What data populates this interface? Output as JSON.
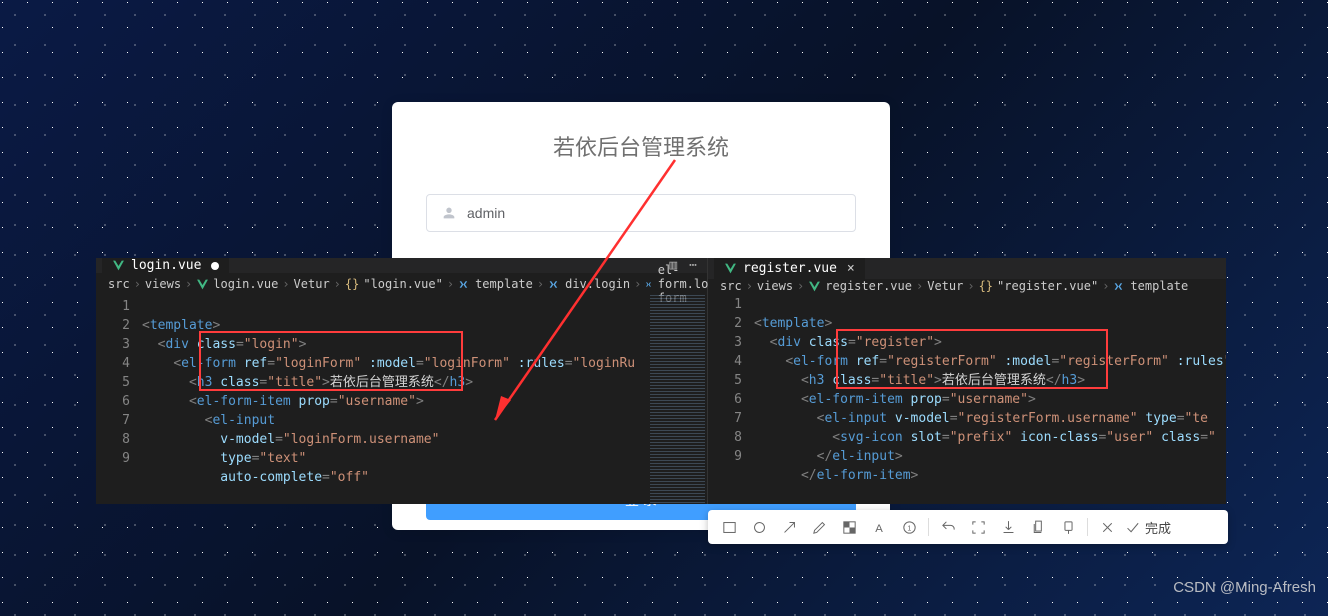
{
  "login_card": {
    "title": "若依后台管理系统",
    "username_value": "admin",
    "submit_label": "登 录"
  },
  "left_pane": {
    "tab": "login.vue",
    "breadcrumb": [
      "src",
      "views",
      "login.vue",
      "Vetur",
      "\"login.vue\"",
      "template",
      "div.login",
      "el-form.login-form"
    ],
    "lines": [
      "1",
      "2",
      "3",
      "4",
      "5",
      "6",
      "7",
      "8",
      "9"
    ]
  },
  "right_pane": {
    "tab": "register.vue",
    "breadcrumb": [
      "src",
      "views",
      "register.vue",
      "Vetur",
      "\"register.vue\"",
      "template"
    ],
    "lines": [
      "1",
      "2",
      "3",
      "4",
      "5",
      "6",
      "7",
      "8",
      "9"
    ]
  },
  "code_left": {
    "l1_template": "template",
    "l2_div": "div",
    "l2_class": "class",
    "l2_classv": "\"login\"",
    "l3_elform": "el-form",
    "l3_ref": "ref",
    "l3_refv": "\"loginForm\"",
    "l3_model": ":model",
    "l3_modelv": "\"loginForm\"",
    "l3_rules": ":rules",
    "l3_rulesv": "\"loginRu",
    "l4_h3": "h3",
    "l4_class": "class",
    "l4_classv": "\"title\"",
    "l4_text": "若依后台管理系统",
    "l5_elfi": "el-form-item",
    "l5_prop": "prop",
    "l5_propv": "\"username\"",
    "l6_elinput": "el-input",
    "l7_vmodel": "v-model",
    "l7_vmodelv": "\"loginForm.username\"",
    "l8_type": "type",
    "l8_typev": "\"text\"",
    "l9_auto": "auto-complete",
    "l9_autov": "\"off\""
  },
  "code_right": {
    "l1_template": "template",
    "l2_div": "div",
    "l2_class": "class",
    "l2_classv": "\"register\"",
    "l3_elform": "el-form",
    "l3_ref": "ref",
    "l3_refv": "\"registerForm\"",
    "l3_model": ":model",
    "l3_modelv": "\"registerForm\"",
    "l3_rules": ":rules",
    "l3_rulesv": "\"",
    "l4_h3": "h3",
    "l4_class": "class",
    "l4_classv": "\"title\"",
    "l4_text": "若依后台管理系统",
    "l5_elfi": "el-form-item",
    "l5_prop": "prop",
    "l5_propv": "\"username\"",
    "l6_elinput": "el-input",
    "l6_vmodel": "v-model",
    "l6_vmodelv": "\"registerForm.username\"",
    "l6_type": "type",
    "l6_typev": "\"te",
    "l7_svgicon": "svg-icon",
    "l7_slot": "slot",
    "l7_slotv": "\"prefix\"",
    "l7_iconclass": "icon-class",
    "l7_iconclassv": "\"user\"",
    "l7_class": "class",
    "l7_classv": "\"",
    "l8_elinput": "el-input",
    "l9_elfi": "el-form-item"
  },
  "sniptool": {
    "done": "完成"
  },
  "credit": "CSDN @Ming-Afresh"
}
